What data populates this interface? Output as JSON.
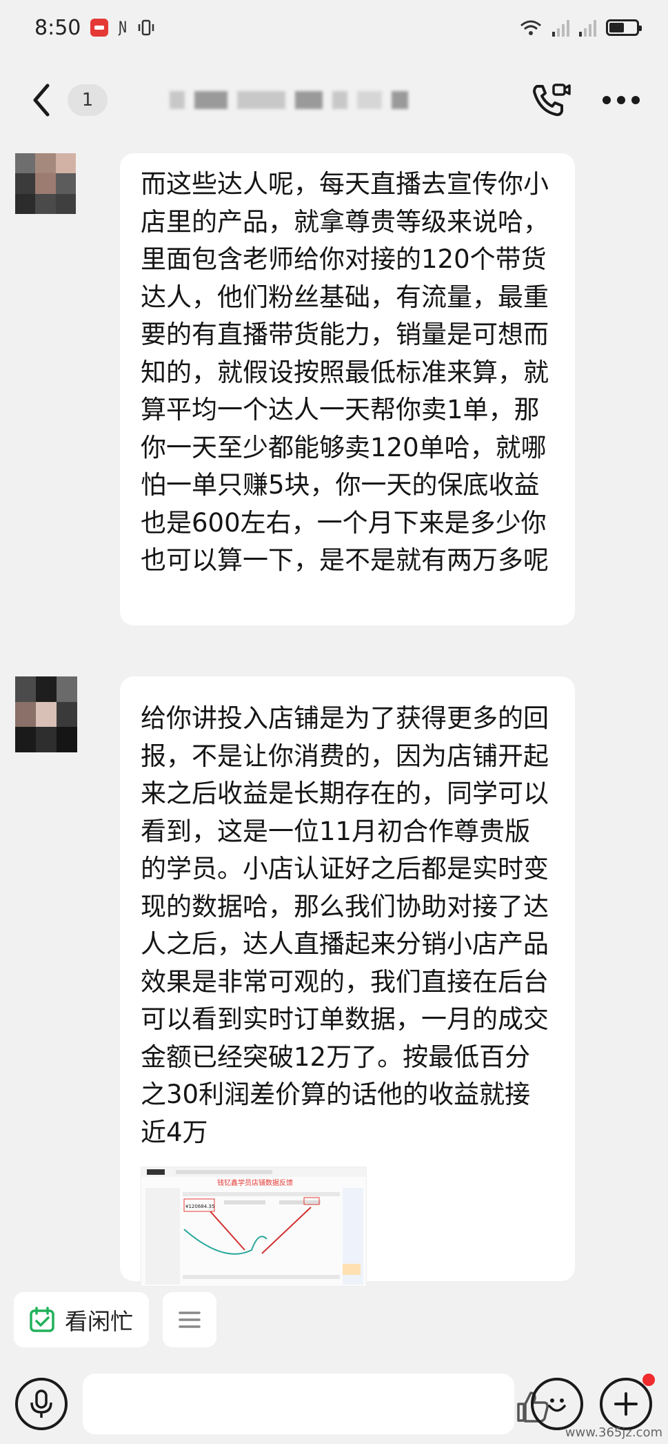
{
  "status_bar": {
    "time": "8:50",
    "battery_level_percent": 60
  },
  "header": {
    "unread_count": "1"
  },
  "messages": [
    {
      "text": "而这些达人呢，每天直播去宣传你小店里的产品，就拿尊贵等级来说哈，里面包含老师给你对接的120个带货达人，他们粉丝基础，有流量，最重要的有直播带货能力，销量是可想而知的，就假设按照最低标准来算，就算平均一个达人一天帮你卖1单，那你一天至少都能够卖120单哈，就哪怕一单只赚5块，你一天的保底收益也是600左右，一个月下来是多少你也可以算一下，是不是就有两万多呢"
    },
    {
      "text": "给你讲投入店铺是为了获得更多的回报，不是让你消费的，因为店铺开起来之后收益是长期存在的，同学可以看到，这是一位11月初合作尊贵版的学员。小店认证好之后都是实时变现的数据哈，那么我们协助对接了达人之后，达人直播起来分销小店产品效果是非常可观的，我们直接在后台可以看到实时订单数据，一月的成交金额已经突破12万了。按最低百分之30利润差价算的话他的收益就接近4万",
      "attachment": {
        "title": "钱钇鑫学员店铺数据反馈",
        "amount": "¥120684.35"
      }
    }
  ],
  "quick_actions": [
    {
      "label": "看闲忙",
      "icon": "calendar-check-icon"
    },
    {
      "label": "",
      "icon": "menu-lines-icon"
    }
  ],
  "input": {
    "placeholder": ""
  },
  "watermark": "www.365jz.com",
  "colors": {
    "background": "#f1f1f1",
    "bubble": "#ffffff",
    "accent_green": "#20b15a",
    "notification_red": "#f02c2c"
  }
}
